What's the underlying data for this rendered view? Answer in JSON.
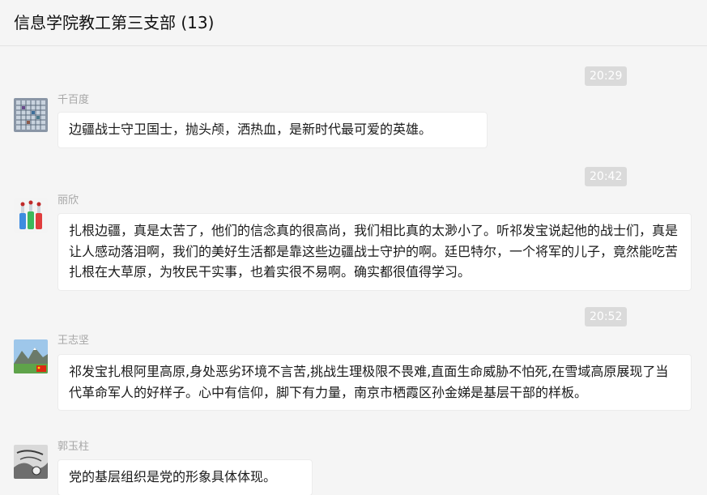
{
  "header": {
    "title": "信息学院教工第三支部 (13)"
  },
  "messages": [
    {
      "time": "20:29",
      "sender": "千百度",
      "avatar_icon": "grid-photo-avatar-icon",
      "text": "边疆战士守卫国士，抛头颅，洒热血，是新时代最可爱的英雄。"
    },
    {
      "time": "20:42",
      "sender": "丽欣",
      "avatar_icon": "bottles-photo-avatar-icon",
      "text": "扎根边疆，真是太苦了，他们的信念真的很高尚，我们相比真的太渺小了。听祁发宝说起他的战士们，真是让人感动落泪啊，我们的美好生活都是靠这些边疆战士守护的啊。廷巴特尔，一个将军的儿子，竟然能吃苦扎根在大草原，为牧民干实事，也着实很不易啊。确实都很值得学习。"
    },
    {
      "time": "20:52",
      "sender": "王志坚",
      "avatar_icon": "mountain-landscape-avatar-icon",
      "text": "祁发宝扎根阿里高原,身处恶劣环境不言苦,挑战生理极限不畏难,直面生命威胁不怕死,在雪域高原展现了当代革命军人的好样子。心中有信仰，脚下有力量，南京市栖霞区孙金娣是基层干部的样板。"
    },
    {
      "time": "",
      "sender": "郭玉柱",
      "avatar_icon": "bw-sketch-avatar-icon",
      "text": "党的基层组织是党的形象具体体现。"
    }
  ],
  "colors": {
    "background": "#f5f5f5",
    "bubble": "#ffffff",
    "time_badge": "#dadada",
    "sender": "#a6a6a6"
  }
}
